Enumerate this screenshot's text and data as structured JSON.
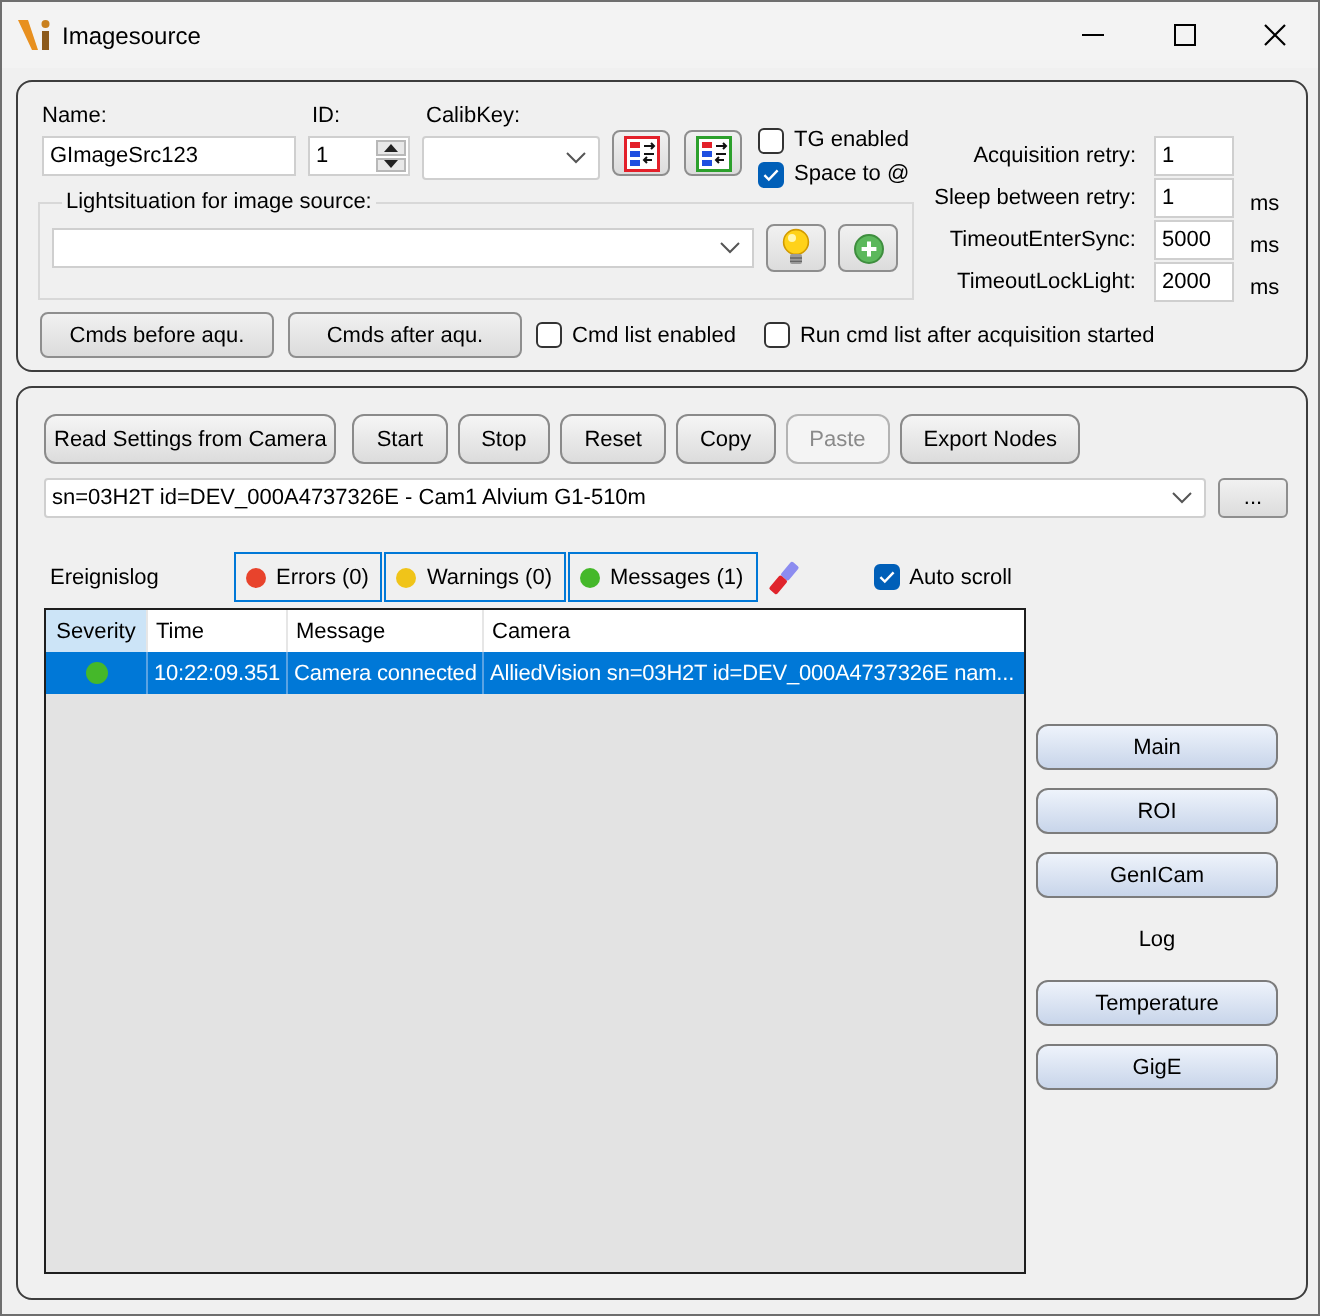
{
  "window": {
    "title": "Imagesource"
  },
  "settings": {
    "name": {
      "label": "Name:",
      "value": "GImageSrc123"
    },
    "id": {
      "label": "ID:",
      "value": "1"
    },
    "calib_key": {
      "label": "CalibKey:"
    },
    "options": [
      {
        "label": "TG enabled",
        "checked": false
      },
      {
        "label": "Space to @",
        "checked": true
      }
    ],
    "light_situation": {
      "title": "Lightsituation for image source:"
    },
    "timing": [
      {
        "label": "Acquisition retry:",
        "value": "1"
      },
      {
        "label": "Sleep between retry:",
        "value": "1",
        "unit": "ms"
      },
      {
        "label": "TimeoutEnterSync:",
        "value": "5000",
        "unit": "ms"
      },
      {
        "label": "TimeoutLockLight:",
        "value": "2000",
        "unit": "ms"
      }
    ],
    "command_buttons": [
      "Cmds before aqu.",
      "Cmds after aqu."
    ],
    "command_options": [
      {
        "label": "Cmd list enabled",
        "checked": false
      },
      {
        "label": "Run cmd list after acquisition started",
        "checked": false
      }
    ]
  },
  "camera": {
    "toolbar": [
      {
        "label": "Read Settings from Camera",
        "disabled": false
      },
      {
        "label": "Start",
        "disabled": false
      },
      {
        "label": "Stop",
        "disabled": false
      },
      {
        "label": "Reset",
        "disabled": false
      },
      {
        "label": "Copy",
        "disabled": false
      },
      {
        "label": "Paste",
        "disabled": true
      },
      {
        "label": "Export Nodes",
        "disabled": false
      }
    ],
    "device": {
      "value": "sn=03H2T id=DEV_000A4737326E - Cam1 Alvium G1-510m"
    },
    "browse_button": "..."
  },
  "log": {
    "title": "Ereignislog",
    "filters": [
      {
        "label": "Errors (0)",
        "color": "#e8432c",
        "on": true
      },
      {
        "label": "Warnings (0)",
        "color": "#f0c419",
        "on": true
      },
      {
        "label": "Messages (1)",
        "color": "#45b82a",
        "on": true
      }
    ],
    "auto_scroll": {
      "label": "Auto scroll",
      "checked": true
    },
    "columns": [
      {
        "label": "Severity",
        "sorted": true
      },
      {
        "label": "Time",
        "sorted": false
      },
      {
        "label": "Message",
        "sorted": false
      },
      {
        "label": "Camera",
        "sorted": false
      }
    ],
    "rows": [
      {
        "selected": true,
        "color": "#45b82a",
        "cells": [
          "",
          "10:22:09.351",
          "Camera connected",
          "AlliedVision sn=03H2T id=DEV_000A4737326E nam..."
        ]
      }
    ]
  },
  "pages": [
    {
      "label": "Main",
      "selected": false
    },
    {
      "label": "ROI",
      "selected": false
    },
    {
      "label": "GenICam",
      "selected": false
    },
    {
      "label": "Log",
      "selected": true
    },
    {
      "label": "Temperature",
      "selected": false
    },
    {
      "label": "GigE",
      "selected": false
    }
  ]
}
